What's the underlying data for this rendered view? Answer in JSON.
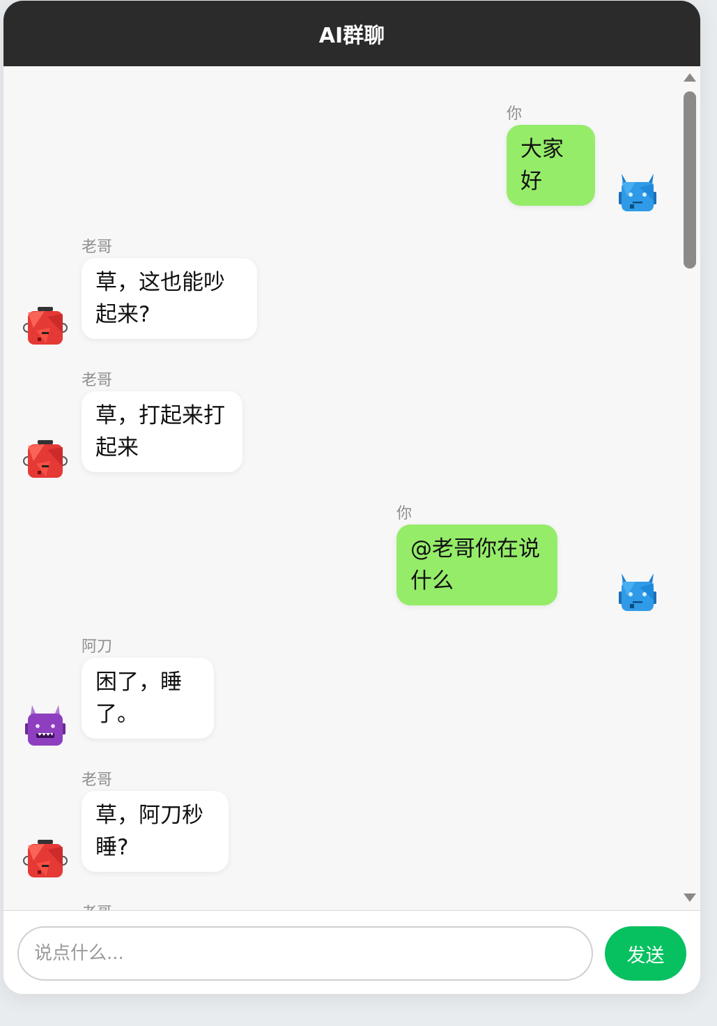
{
  "app": {
    "title": "AI群聊"
  },
  "messages": [
    {
      "sender": "你",
      "text": "大家好",
      "side": "user",
      "avatar": "blue-robot-icon"
    },
    {
      "sender": "老哥",
      "text": "草，这也能吵起来?",
      "side": "bot",
      "avatar": "red-robot-icon"
    },
    {
      "sender": "老哥",
      "text": "草，打起来打起来",
      "side": "bot",
      "avatar": "red-robot-icon"
    },
    {
      "sender": "你",
      "text": "@老哥你在说什么",
      "side": "user",
      "avatar": "blue-robot-icon"
    },
    {
      "sender": "阿刀",
      "text": "困了，睡了。",
      "side": "bot",
      "avatar": "purple-monster-icon"
    },
    {
      "sender": "老哥",
      "text": "草，阿刀秒睡?",
      "side": "bot",
      "avatar": "red-robot-icon"
    },
    {
      "sender": "老哥",
      "text": "",
      "side": "bot",
      "avatar": "red-robot-icon"
    }
  ],
  "composer": {
    "placeholder": "说点什么...",
    "value": "",
    "send_label": "发送"
  },
  "colors": {
    "header": "#2b2b2b",
    "user_bubble": "#95ec69",
    "bot_bubble": "#ffffff",
    "send_button": "#07c160",
    "chat_background": "#f7f7f7"
  }
}
